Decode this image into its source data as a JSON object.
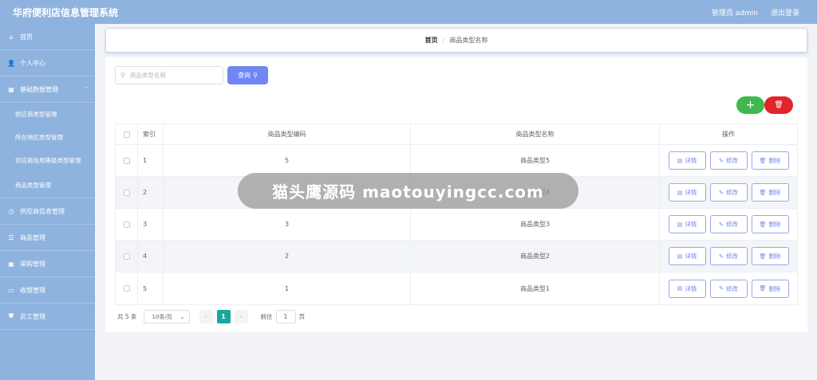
{
  "header": {
    "title": "华府便利店信息管理系统",
    "user": "管理员 admin",
    "logout": "退出登录"
  },
  "sidebar": {
    "items": [
      {
        "label": "首页",
        "icon": "home-icon",
        "glyph": "⌂"
      },
      {
        "label": "个人中心",
        "icon": "user-icon",
        "glyph": "👤"
      },
      {
        "label": "基础数据管理",
        "icon": "grid-icon",
        "glyph": "▦",
        "arrow": "⌃"
      },
      {
        "label": "供应商类型管理",
        "sub": true
      },
      {
        "label": "所在地区类型管理",
        "sub": true
      },
      {
        "label": "供应商信用等级类型管理",
        "sub": true
      },
      {
        "label": "商品类型管理",
        "simple": true
      },
      {
        "label": "供应商信息管理",
        "icon": "clock-icon",
        "glyph": "◷",
        "arrow": "⌄"
      },
      {
        "label": "商品管理",
        "icon": "list-icon",
        "glyph": "☰",
        "arrow": "⌄"
      },
      {
        "label": "采购管理",
        "icon": "cart-icon",
        "glyph": "▣",
        "arrow": "⌄"
      },
      {
        "label": "收银管理",
        "icon": "cash-icon",
        "glyph": "▭",
        "arrow": "⌄"
      },
      {
        "label": "员工管理",
        "icon": "shield-icon",
        "glyph": "⛊",
        "arrow": "⌄"
      }
    ]
  },
  "breadcrumb": {
    "home": "首页",
    "separator": "/",
    "current": "商品类型名称"
  },
  "search": {
    "placeholder": "商品类型名称",
    "button": "查询"
  },
  "toolbar": {
    "add": "+",
    "delete": "🗑"
  },
  "table": {
    "headers": {
      "index": "索引",
      "code": "商品类型编码",
      "name": "商品类型名称",
      "ops": "操作"
    },
    "rows": [
      {
        "index": "1",
        "code": "5",
        "name": "商品类型5"
      },
      {
        "index": "2",
        "code": "4",
        "name": "商品类型4"
      },
      {
        "index": "3",
        "code": "3",
        "name": "商品类型3"
      },
      {
        "index": "4",
        "code": "2",
        "name": "商品类型2"
      },
      {
        "index": "5",
        "code": "1",
        "name": "商品类型1"
      }
    ],
    "ops": {
      "detail": "详情",
      "edit": "修改",
      "delete": "删除"
    }
  },
  "pagination": {
    "total": "共 5 条",
    "page_size": "10条/页",
    "prev": "‹",
    "current": "1",
    "next": "›",
    "goto": "前往",
    "goto_value": "1",
    "page_unit": "页"
  },
  "overlay": {
    "text": "猫头鹰源码 maotouyingcc.com"
  }
}
